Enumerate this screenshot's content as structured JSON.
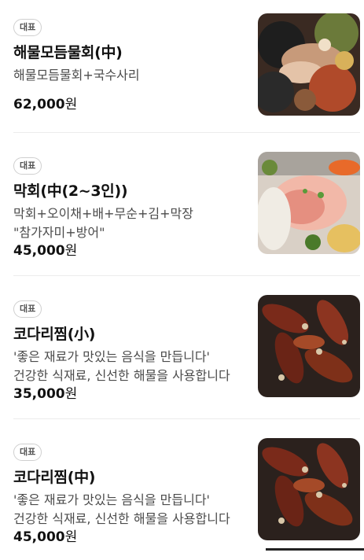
{
  "menu": {
    "items": [
      {
        "badge": "대표",
        "name": "해물모듬물회(中)",
        "description": "해물모듬물회+국수사리",
        "price": "62,000",
        "currency": "원",
        "image": "seafood-mulhoe-photo"
      },
      {
        "badge": "대표",
        "name": "막회(中(2~3인))",
        "description": "막회+오이채+배+무순+김+막장 \"참가자미+방어\"",
        "price": "45,000",
        "currency": "원",
        "image": "makhoe-photo"
      },
      {
        "badge": "대표",
        "name": "코다리찜(小)",
        "description": "'좋은 재료가 맛있는 음식을 만듭니다' 건강한 식재료, 신선한 해물을 사용합니다",
        "price": "35,000",
        "currency": "원",
        "image": "kodari-jjim-photo"
      },
      {
        "badge": "대표",
        "name": "코다리찜(中)",
        "description": "'좋은 재료가 맛있는 음식을 만듭니다' 건강한 식재료, 신선한 해물을 사용합니다",
        "price": "45,000",
        "currency": "원",
        "image": "kodari-jjim-photo"
      }
    ]
  }
}
